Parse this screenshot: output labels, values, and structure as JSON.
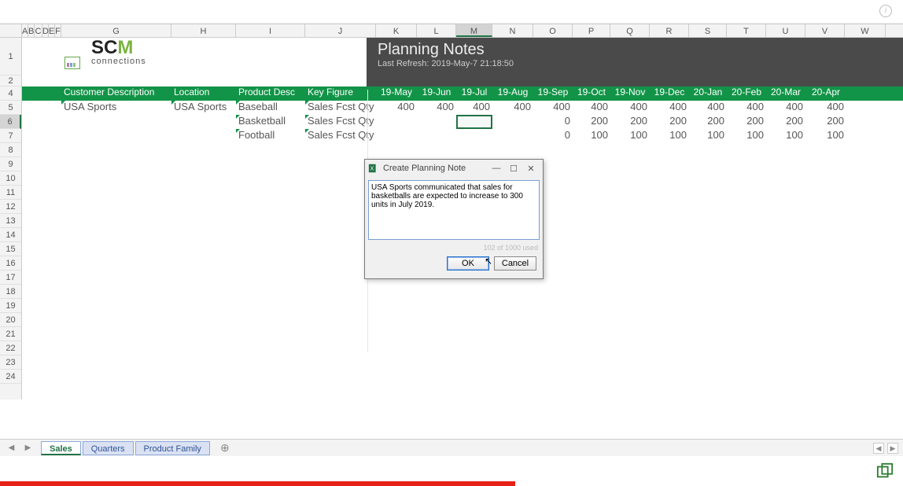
{
  "logo": {
    "top_a": "SC",
    "top_b": "M",
    "bottom": "connections"
  },
  "banner": {
    "title": "Planning Notes",
    "refresh": "Last Refresh: 2019-May-7   21:18:50"
  },
  "cols_narrow": [
    "A",
    "B",
    "C",
    "D",
    "E",
    "F"
  ],
  "cols": [
    "G",
    "H",
    "I",
    "J",
    "K",
    "L",
    "M",
    "N",
    "O",
    "P",
    "Q",
    "R",
    "S",
    "T",
    "U",
    "V",
    "W"
  ],
  "rows": [
    "1",
    "2",
    "4",
    "5",
    "6",
    "7",
    "8",
    "9",
    "10",
    "11",
    "12",
    "13",
    "14",
    "15",
    "16",
    "17",
    "18",
    "19",
    "20",
    "21",
    "22",
    "23",
    "24"
  ],
  "hdr": {
    "cust": "Customer Description",
    "loc": "Location",
    "prod": "Product Desc",
    "key": "Key Figure",
    "months": [
      "19-May",
      "19-Jun",
      "19-Jul",
      "19-Aug",
      "19-Sep",
      "19-Oct",
      "19-Nov",
      "19-Dec",
      "20-Jan",
      "20-Feb",
      "20-Mar",
      "20-Apr"
    ]
  },
  "data": {
    "r5": {
      "cust": "USA Sports",
      "loc": "USA Sports",
      "prod": "Baseball",
      "key": "Sales Fcst Qty",
      "vals": [
        "400",
        "400",
        "400",
        "400",
        "400",
        "400",
        "400",
        "400",
        "400",
        "400",
        "400",
        "400"
      ]
    },
    "r6": {
      "prod": "Basketball",
      "key": "Sales Fcst Qty",
      "vals_partial": {
        "p4": "0",
        "p5": "200",
        "p6": "200",
        "p7": "200",
        "p8": "200",
        "p9": "200",
        "p10": "200",
        "p11": "200"
      }
    },
    "r7": {
      "prod": "Football",
      "key": "Sales Fcst Qty",
      "vals_partial": {
        "p4": "0",
        "p5": "100",
        "p6": "100",
        "p7": "100",
        "p8": "100",
        "p9": "100",
        "p10": "100",
        "p11": "100"
      }
    }
  },
  "tabs": {
    "sales": "Sales",
    "quarters": "Quarters",
    "family": "Product Family"
  },
  "dialog": {
    "title": "Create Planning Note",
    "text": "USA Sports communicated that sales for basketballs are expected to increase to 300 units in July 2019.",
    "count": "102 of 1000 used",
    "ok": "OK",
    "cancel": "Cancel",
    "min": "—",
    "max": "☐",
    "close": "✕"
  },
  "chart_data": {
    "type": "table",
    "title": "Planning Notes",
    "columns": [
      "Customer Description",
      "Location",
      "Product Desc",
      "Key Figure",
      "19-May",
      "19-Jun",
      "19-Jul",
      "19-Aug",
      "19-Sep",
      "19-Oct",
      "19-Nov",
      "19-Dec",
      "20-Jan",
      "20-Feb",
      "20-Mar",
      "20-Apr"
    ],
    "rows": [
      [
        "USA Sports",
        "USA Sports",
        "Baseball",
        "Sales Fcst Qty",
        400,
        400,
        400,
        400,
        400,
        400,
        400,
        400,
        400,
        400,
        400,
        400
      ],
      [
        "",
        "",
        "Basketball",
        "Sales Fcst Qty",
        null,
        null,
        null,
        null,
        null,
        200,
        200,
        200,
        200,
        200,
        200,
        200
      ],
      [
        "",
        "",
        "Football",
        "Sales Fcst Qty",
        null,
        null,
        null,
        null,
        null,
        100,
        100,
        100,
        100,
        100,
        100,
        100
      ]
    ]
  }
}
